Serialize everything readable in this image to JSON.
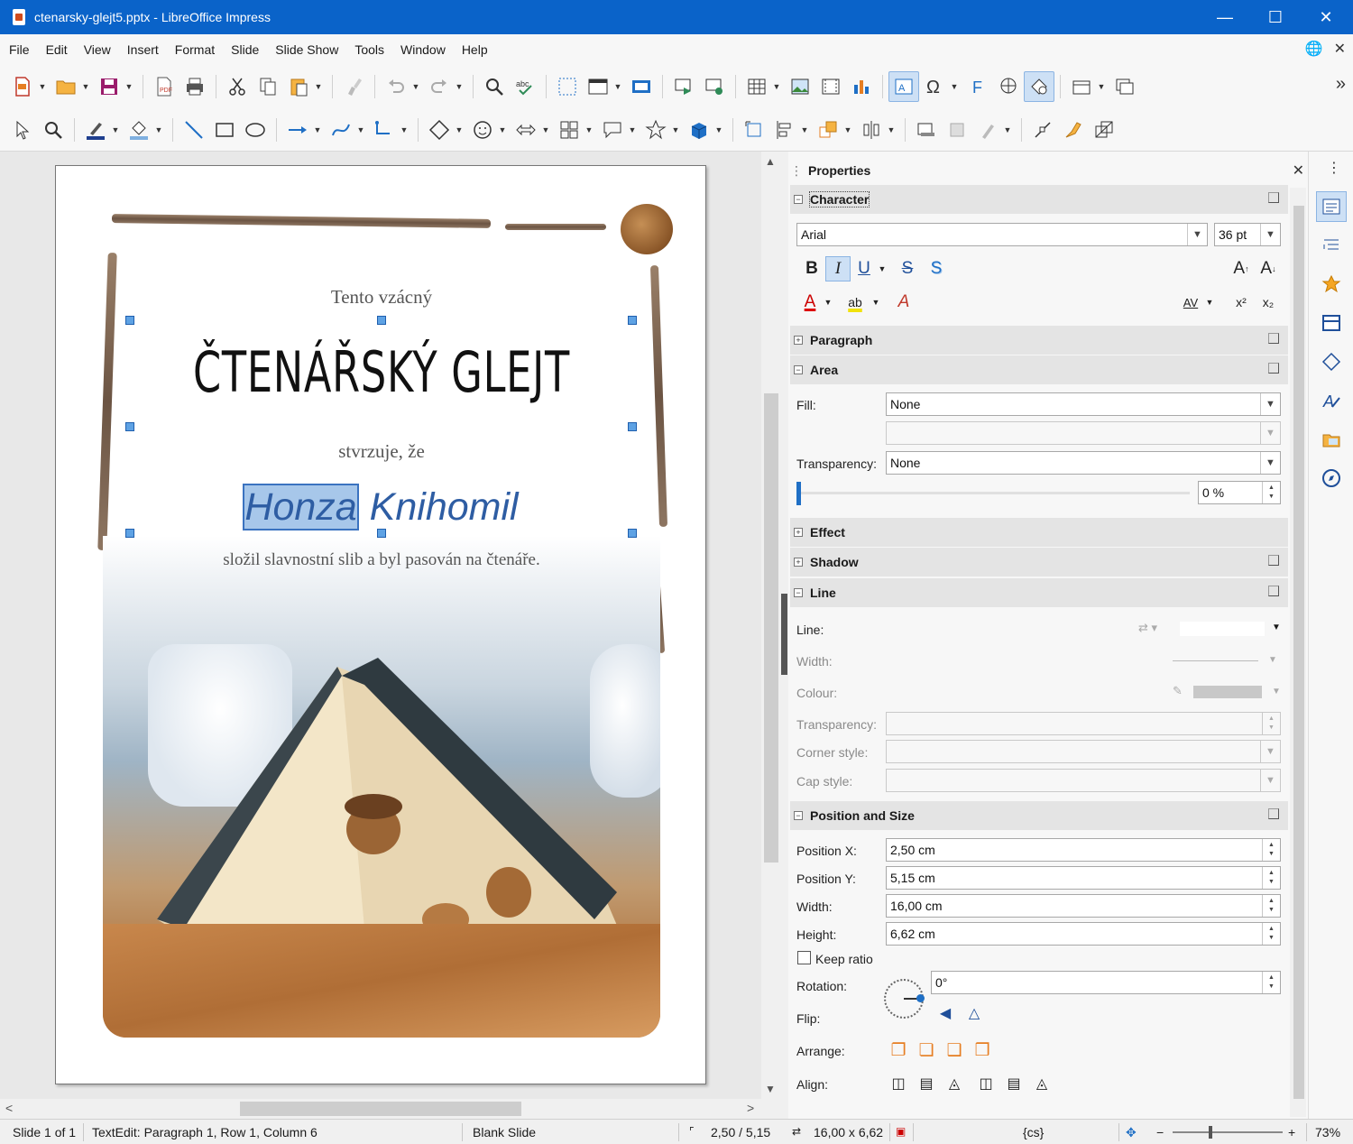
{
  "window": {
    "title": "ctenarsky-glejt5.pptx - LibreOffice Impress"
  },
  "menu": [
    "File",
    "Edit",
    "View",
    "Insert",
    "Format",
    "Slide",
    "Slide Show",
    "Tools",
    "Window",
    "Help"
  ],
  "slide": {
    "line1": "Tento vzácný",
    "title": "ČTENÁŘSKÝ GLEJT",
    "line2": "stvrzuje, že",
    "name_selected": "Honza",
    "name_rest": " Knihomil",
    "line3": "složil slavnostní slib a byl pasován na čtenáře."
  },
  "sidebar": {
    "title": "Properties",
    "character": {
      "label": "Character",
      "font": "Arial",
      "size": "36 pt",
      "bold": "B",
      "italic": "I",
      "underline": "U",
      "strike": "S",
      "shadow": "S",
      "grow": "A",
      "shrink": "A",
      "font_color": "A",
      "highlight": "ab",
      "spacing": "AV",
      "superscript": "x²",
      "subscript": "x₂"
    },
    "paragraph": {
      "label": "Paragraph"
    },
    "area": {
      "label": "Area",
      "fill_label": "Fill:",
      "fill": "None",
      "transparency_label": "Transparency:",
      "transparency": "None",
      "percent": "0 %"
    },
    "effect": {
      "label": "Effect"
    },
    "shadow": {
      "label": "Shadow"
    },
    "line": {
      "label": "Line",
      "line_label": "Line:",
      "width_label": "Width:",
      "colour_label": "Colour:",
      "transparency_label": "Transparency:",
      "corner_label": "Corner style:",
      "cap_label": "Cap style:"
    },
    "position": {
      "label": "Position and Size",
      "x_label": "Position X:",
      "x": "2,50 cm",
      "y_label": "Position Y:",
      "y": "5,15 cm",
      "w_label": "Width:",
      "w": "16,00 cm",
      "h_label": "Height:",
      "h": "6,62 cm",
      "keep_ratio": "Keep ratio",
      "rotation_label": "Rotation:",
      "rotation": "0°",
      "flip_label": "Flip:",
      "arrange_label": "Arrange:",
      "align_label": "Align:"
    }
  },
  "status": {
    "slide": "Slide 1 of 1",
    "edit": "TextEdit: Paragraph 1, Row 1, Column 6",
    "layout": "Blank Slide",
    "pos": "2,50 / 5,15",
    "size": "16,00 x 6,62",
    "lang": "{cs}",
    "zoom": "73%"
  },
  "colors": {
    "titlebar": "#0a63c9",
    "accent": "#2e5da3",
    "selection": "#a7c7ea"
  }
}
